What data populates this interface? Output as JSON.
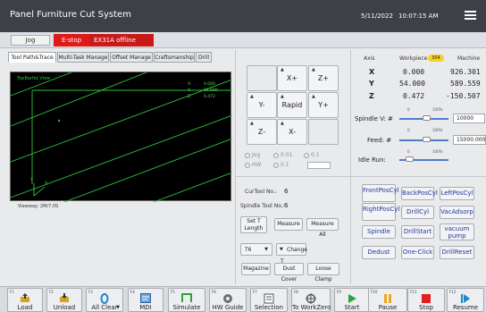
{
  "app": {
    "title": "Panel Furniture Cut System",
    "date": "5/11/2022",
    "time": "10:07:15 AM"
  },
  "status": {
    "jog": "Jog",
    "estop": "E-stop",
    "offline": "EX31A offline"
  },
  "tabs": [
    "Tool Path&Trace",
    "Multi-Task Manage",
    "Offset Manage",
    "Craftsmanship",
    "Drill"
  ],
  "view": {
    "label": "TopBarfet View",
    "readouts": [
      {
        "axis": "X:",
        "value": "0.000"
      },
      {
        "axis": "Y:",
        "value": "54.000"
      },
      {
        "axis": "Z:",
        "value": "0.472"
      }
    ],
    "caption": "Viewway: 2M/7.0S",
    "axis_x": "X",
    "axis_y": "Y",
    "colors": {
      "background": "#000000",
      "path": "#2fbf3a"
    }
  },
  "jog": {
    "x_plus": "X+",
    "z_plus": "Z+",
    "y_minus": "Y-",
    "rapid": "Rapid",
    "y_plus": "Y+",
    "z_minus": "Z-",
    "x_minus": "X-",
    "modes": [
      "Jog",
      "0.01",
      "0.1",
      "HW",
      "0.1"
    ]
  },
  "axes": {
    "headers": [
      "Axis",
      "Workpiece",
      "Machine"
    ],
    "badge": "304",
    "rows": [
      {
        "axis": "X",
        "workpiece": "0.000",
        "machine": "926.301"
      },
      {
        "axis": "Y",
        "workpiece": "54.000",
        "machine": "589.559"
      },
      {
        "axis": "Z",
        "workpiece": "0.472",
        "machine": "-150.507"
      }
    ]
  },
  "overrides": {
    "spindle": {
      "label": "Spindle V: #",
      "value": "10000",
      "tick_low": "0",
      "tick_high": "100%",
      "level": 0.55
    },
    "feed": {
      "label": "Feed: #",
      "value": "15000.000",
      "tick_low": "0",
      "tick_high": "100%",
      "level": 0.55
    },
    "idle": {
      "label": "Idle Run:",
      "tick_low": "0",
      "tick_high": "100%",
      "level": 0.2
    }
  },
  "tool": {
    "cur_label": "CurTool No.:",
    "cur_value": "6",
    "spindle_label": "Spindle Tool No.:",
    "spindle_value": "6",
    "set_length": "Set T Length",
    "measure": "Measure",
    "measure_all": "Measure All",
    "tool_select": "T6",
    "change": "Change T",
    "magazine": "Magazine",
    "dust_cover": "Dust Cover",
    "loose_clamp": "Loose Clamp"
  },
  "buttons": {
    "front_pos": "FrontPosCyl",
    "back_pos": "BackPosCyl",
    "left_pos": "LeftPosCyl",
    "right_pos": "RightPosCyl",
    "drill_cyl": "DrillCyl",
    "vac_adsorp": "VacAdsorp",
    "spindle": "Spindle",
    "drill_start": "DrillStart",
    "vacuum_pump": "vacuum pump",
    "dedust": "Dedust",
    "one_click": "One-Click",
    "drill_reset": "DrillReset"
  },
  "fkeys": [
    {
      "num": "F1",
      "label": "Load",
      "icon": "load-icon"
    },
    {
      "num": "F2",
      "label": "Unload",
      "icon": "unload-icon"
    },
    {
      "num": "F3",
      "label": "All Clear",
      "icon": "all-clear-icon"
    },
    {
      "num": "F4",
      "label": "MDI",
      "icon": "mdi-icon"
    },
    {
      "num": "F5",
      "label": "Simulate",
      "icon": "simulate-icon"
    },
    {
      "num": "F6",
      "label": "HW Guide",
      "icon": "hw-guide-icon"
    },
    {
      "num": "F7",
      "label": "Selection",
      "icon": "selection-icon"
    },
    {
      "num": "F8",
      "label": "To WorkZero",
      "icon": "to-workzero-icon"
    },
    {
      "num": "F9",
      "label": "Start",
      "icon": "start-icon"
    },
    {
      "num": "F10",
      "label": "Pause",
      "icon": "pause-icon"
    },
    {
      "num": "F11",
      "label": "Stop",
      "icon": "stop-icon"
    },
    {
      "num": "F12",
      "label": "Resume",
      "icon": "resume-icon"
    }
  ],
  "colors": {
    "titlebar": "#3d4047",
    "estop": "#e01919",
    "accent": "#4f7cc7",
    "badge": "#f5d325",
    "start": "#2aa63a",
    "pause": "#f0a51d",
    "stop": "#e02020"
  }
}
